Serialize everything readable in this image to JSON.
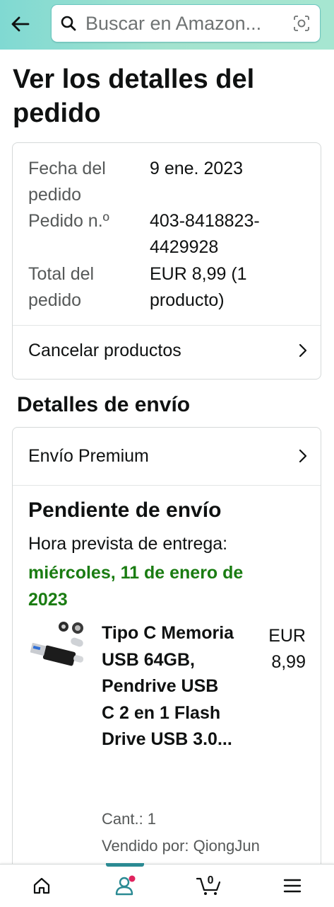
{
  "header": {
    "search_placeholder": "Buscar en Amazon..."
  },
  "page": {
    "title": "Ver los detalles del pedido"
  },
  "summary": {
    "order_date_label": "Fecha del pedido",
    "order_date_value": "9 ene. 2023",
    "order_number_label": "Pedido n.º",
    "order_number_value": "403-8418823-4429928",
    "total_label": "Total del pedido",
    "total_value": "EUR 8,99 (1 producto)",
    "cancel_label": "Cancelar productos"
  },
  "shipping": {
    "heading": "Detalles de envío",
    "service": "Envío Premium",
    "status": "Pendiente de envío",
    "eta_label": "Hora prevista de entrega:",
    "eta_date": "miércoles, 11 de enero de 2023",
    "item": {
      "name": "Tipo C Memoria USB 64GB, Pendrive USB C 2 en 1 Flash Drive USB 3.0...",
      "price": "EUR 8,99",
      "quantity": "Cant.: 1",
      "seller": "Vendido por: QiongJun"
    }
  },
  "nav": {
    "cart_count": "0",
    "items": [
      "home-icon",
      "account-icon",
      "cart-icon",
      "menu-icon"
    ]
  },
  "colors": {
    "accent": "#1a7c12",
    "header": "#a6e6d1",
    "nav_active": "#2a8a93"
  }
}
